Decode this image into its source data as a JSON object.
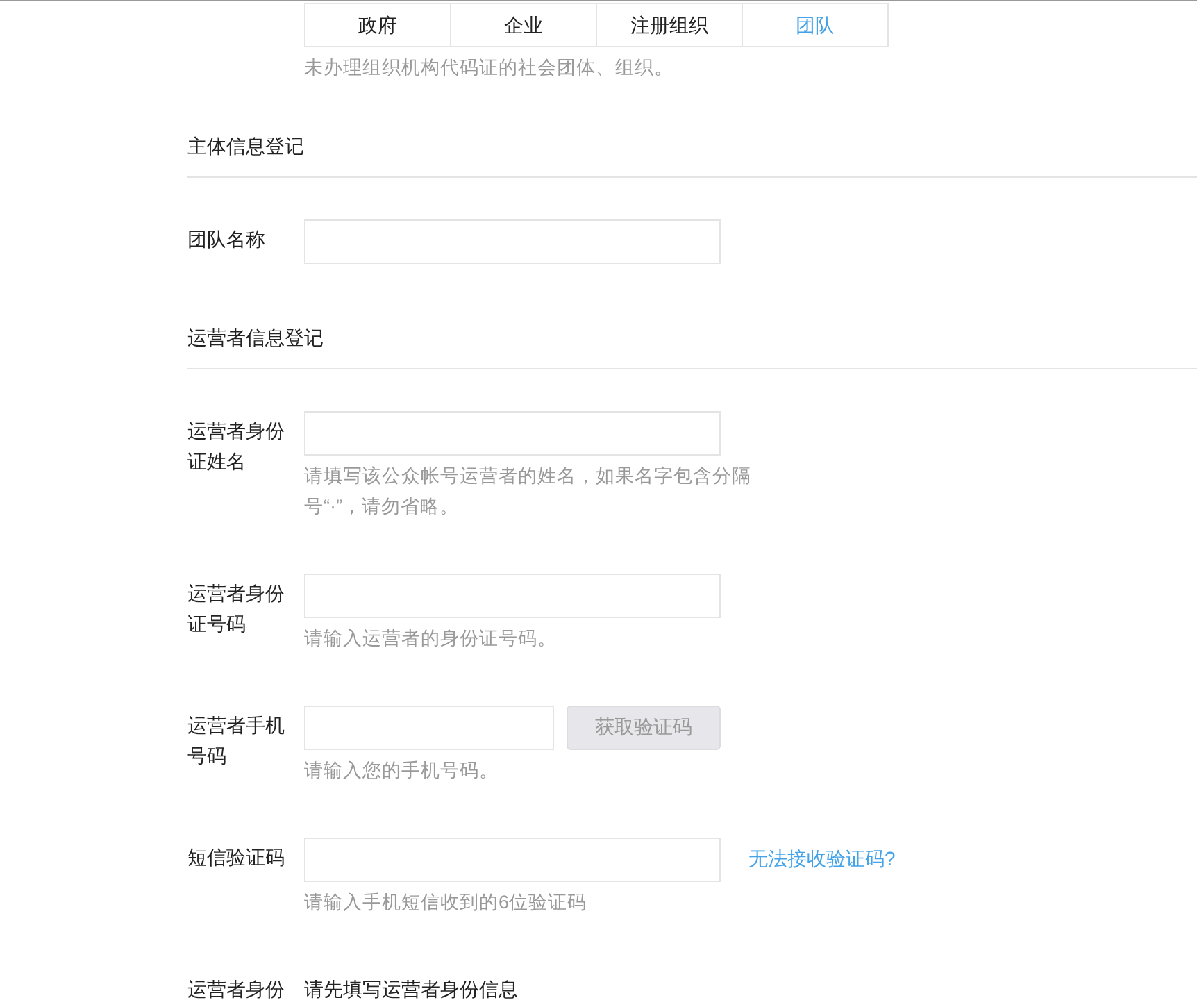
{
  "org_type_tabs": [
    {
      "label": "政府",
      "selected": false
    },
    {
      "label": "企业",
      "selected": false
    },
    {
      "label": "注册组织",
      "selected": false
    },
    {
      "label": "团队",
      "selected": true
    }
  ],
  "org_type_hint": "未办理组织机构代码证的社会团体、组织。",
  "sections": [
    {
      "title": "主体信息登记",
      "fields": [
        {
          "kind": "input",
          "label": "团队名称"
        }
      ]
    },
    {
      "title": "运营者信息登记",
      "fields": [
        {
          "kind": "input",
          "label": "运营者身份证姓名",
          "hint": "请填写该公众帐号运营者的姓名，如果名字包含分隔号“·”，请勿省略。"
        },
        {
          "kind": "input",
          "label": "运营者身份证号码",
          "hint": "请输入运营者的身份证号码。"
        },
        {
          "kind": "input_button",
          "label": "运营者手机号码",
          "button": {
            "label": "获取验证码",
            "disabled": true
          },
          "hint": "请输入您的手机号码。"
        },
        {
          "kind": "input_link",
          "label": "短信验证码",
          "link": "无法接收验证码?",
          "hint": "请输入手机短信收到的6位验证码"
        },
        {
          "kind": "info",
          "label": "运营者身份",
          "value": "请先填写运营者身份信息"
        }
      ]
    }
  ]
}
